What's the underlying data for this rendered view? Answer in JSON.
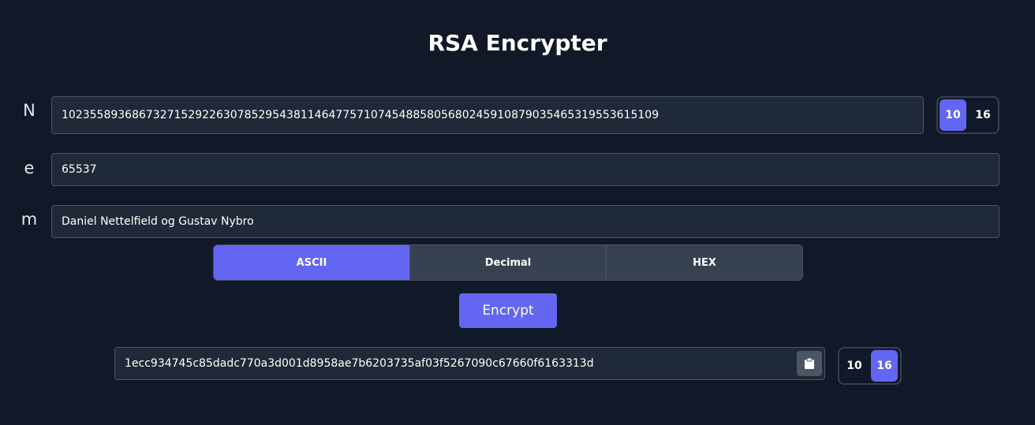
{
  "title": "RSA Encrypter",
  "fields": {
    "n": {
      "label": "N",
      "value": "1023558936867327152922630785295438114647757107454885805680245910879035465319553615109"
    },
    "e": {
      "label": "e",
      "value": "65537"
    },
    "m": {
      "label": "m",
      "value": "Daniel Nettelfield og Gustav Nybro"
    }
  },
  "n_base_toggle": {
    "options": [
      "10",
      "16"
    ],
    "selected": "10"
  },
  "message_format": {
    "options": [
      "ASCII",
      "Decimal",
      "HEX"
    ],
    "selected": "ASCII"
  },
  "encrypt_label": "Encrypt",
  "output": {
    "value": "1ecc934745c85dadc770a3d001d8958ae7b6203735af03f5267090c67660f6163313d",
    "copy_icon": "clipboard-icon"
  },
  "output_base_toggle": {
    "options": [
      "10",
      "16"
    ],
    "selected": "16"
  },
  "colors": {
    "background": "#111827",
    "input_background": "#1f2937",
    "accent": "#6366f1",
    "button_inactive": "#374151"
  }
}
